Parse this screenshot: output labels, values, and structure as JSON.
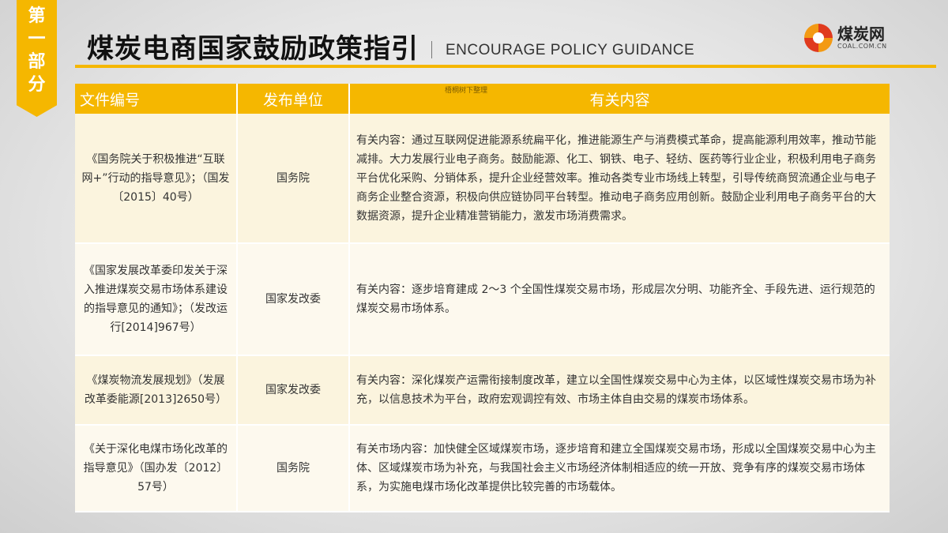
{
  "section_tag": [
    "第",
    "一",
    "部",
    "分"
  ],
  "title": "煤炭电商国家鼓励政策指引",
  "subtitle": "ENCOURAGE POLICY GUIDANCE",
  "logo": {
    "name": "煤炭网",
    "domain": "COAL.COM.CN"
  },
  "table": {
    "headers": [
      "文件编号",
      "发布单位",
      "有关内容"
    ],
    "note": "梧桐树下整理",
    "rows": [
      {
        "doc": "《国务院关于积极推进“互联网+”行动的指导意见》；（国发〔2015〕40号）",
        "unit": "国务院",
        "content": "有关内容：通过互联网促进能源系统扁平化，推进能源生产与消费模式革命，提高能源利用效率，推动节能减排。大力发展行业电子商务。鼓励能源、化工、钢铁、电子、轻纺、医药等行业企业，积极利用电子商务平台优化采购、分销体系，提升企业经营效率。推动各类专业市场线上转型，引导传统商贸流通企业与电子商务企业整合资源，积极向供应链协同平台转型。推动电子商务应用创新。鼓励企业利用电子商务平台的大数据资源，提升企业精准营销能力，激发市场消费需求。"
      },
      {
        "doc": "《国家发展改革委印发关于深入推进煤炭交易市场体系建设的指导意见的通知》；（发改运行[2014]967号）",
        "unit": "国家发改委",
        "content": "有关内容：逐步培育建成 2～3 个全国性煤炭交易市场，形成层次分明、功能齐全、手段先进、运行规范的煤炭交易市场体系。"
      },
      {
        "doc": "《煤炭物流发展规划》（发展改革委能源[2013]2650号）",
        "unit": "国家发改委",
        "content": "有关内容：深化煤炭产运需衔接制度改革，建立以全国性煤炭交易中心为主体，以区域性煤炭交易市场为补充，以信息技术为平台，政府宏观调控有效、市场主体自由交易的煤炭市场体系。"
      },
      {
        "doc": "《关于深化电煤市场化改革的指导意见》（国办发〔2012〕57号）",
        "unit": "国务院",
        "content": "有关市场内容：加快健全区域煤炭市场，逐步培育和建立全国煤炭交易市场，形成以全国煤炭交易中心为主体、区域煤炭市场为补充，与我国社会主义市场经济体制相适应的统一开放、竞争有序的煤炭交易市场体系，为实施电煤市场化改革提供比较完善的市场载体。"
      }
    ]
  }
}
